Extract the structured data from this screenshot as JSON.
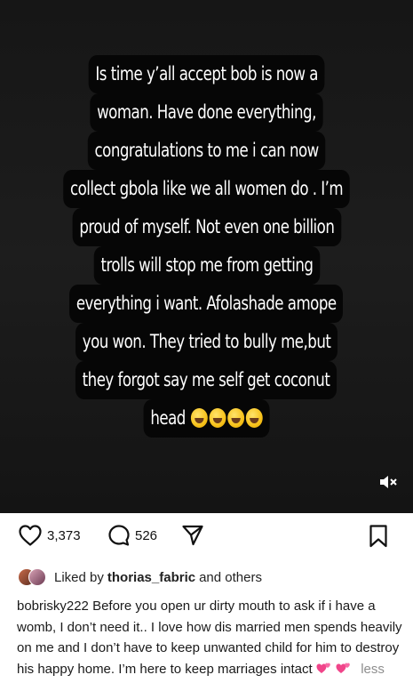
{
  "story": {
    "lines": [
      "Is time y’all accept bob is now a",
      "woman. Have done everything,",
      "congratulations to me i can now",
      "collect gbola like we all women do . I’m",
      "proud of myself. Not even one billion",
      "trolls will stop me from getting",
      "everything i want. Afolashade amope",
      "you won. They tried to bully me,but",
      "they forgot say me self get coconut",
      "head"
    ],
    "emoji_name": "rolling-on-floor-laughing-emoji",
    "emoji_count": 4,
    "mute_icon": "speaker-muted-icon"
  },
  "actions": {
    "likes": "3,373",
    "comments": "526",
    "like_icon": "heart-outline-icon",
    "comment_icon": "comment-bubble-icon",
    "share_icon": "send-paper-plane-icon",
    "save_icon": "bookmark-icon"
  },
  "liked_by": {
    "prefix": "Liked by",
    "name": "thorias_fabric",
    "suffix": "and others"
  },
  "caption": {
    "username": "bobrisky222",
    "text": "Before you open ur dirty mouth to ask if i have a womb, I don’t need it.. I love how dis married men spends heavily on me and I don’t have to keep unwanted child for him to destroy his happy home. I’m here to keep marriages intact",
    "emoji_name": "two-hearts-emoji",
    "more_label": "less"
  },
  "colors": {
    "media_bg": "#1a1a1a",
    "text_bg": "#060606",
    "heart_pink": "#f0458a",
    "muted_gray": "#8e8e8e"
  }
}
